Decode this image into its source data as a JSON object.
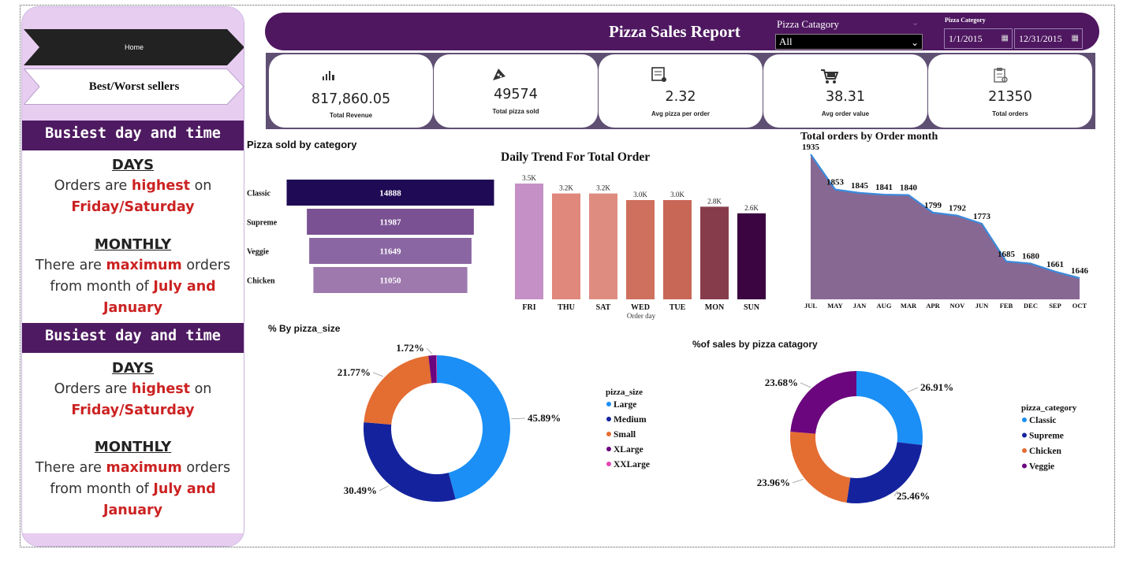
{
  "sidebar": {
    "nav": [
      {
        "label": "Home"
      },
      {
        "label": "Best/Worst sellers"
      }
    ],
    "sections": [
      {
        "banner": "Busiest day and time",
        "days_heading": "DAYS",
        "days_pre": "Orders are",
        "days_highlight": "highest",
        "days_post": "on",
        "days_value": "Friday/Saturday",
        "monthly_heading": "MONTHLY",
        "monthly_pre": "There are",
        "monthly_highlight": "maximum",
        "monthly_post": "orders",
        "monthly_line2": "from month of",
        "monthly_value1": "July and",
        "monthly_value2": "January"
      },
      {
        "banner": "Busiest day and time",
        "days_heading": "DAYS",
        "days_pre": "Orders are",
        "days_highlight": "highest",
        "days_post": "on",
        "days_value": "Friday/Saturday",
        "monthly_heading": "MONTHLY",
        "monthly_pre": "There are",
        "monthly_highlight": "maximum",
        "monthly_post": "orders",
        "monthly_line2": "from month of",
        "monthly_value1": "July and",
        "monthly_value2": "January"
      }
    ]
  },
  "header": {
    "title": "Pizza Sales Report",
    "category_filter_label": "Pizza Catagory",
    "category_filter_value": "All",
    "date_filter_label": "Pizza Category",
    "date_start": "1/1/2015",
    "date_end": "12/31/2015"
  },
  "kpis": [
    {
      "icon": "bar-chart-icon",
      "value": "817,860.05",
      "label": "Total Revenue"
    },
    {
      "icon": "pizza-icon",
      "value": "49574",
      "label": "Total pizza sold"
    },
    {
      "icon": "receipt-icon",
      "value": "2.32",
      "label": "Avg pizza per order"
    },
    {
      "icon": "cart-icon",
      "value": "38.31",
      "label": "Avg order value"
    },
    {
      "icon": "clipboard-icon",
      "value": "21350",
      "label": "Total orders"
    }
  ],
  "colors": {
    "purple_dark": "#4e1760",
    "accent_red": "#cc2222",
    "area_fill": "#876893",
    "area_line": "#3b8bdc"
  },
  "chart_data": [
    {
      "id": "category_funnel",
      "type": "bar",
      "title": "Pizza sold by category",
      "categories": [
        "Classic",
        "Supreme",
        "Veggie",
        "Chicken"
      ],
      "values": [
        14888,
        11987,
        11649,
        11050
      ],
      "colors": [
        "#1f0a55",
        "#7a5192",
        "#8a66a2",
        "#9d79ad"
      ]
    },
    {
      "id": "daily_trend",
      "type": "bar",
      "title": "Daily Trend For Total Order",
      "xlabel": "Order day",
      "categories": [
        "FRI",
        "THU",
        "SAT",
        "WED",
        "TUE",
        "MON",
        "SUN"
      ],
      "values": [
        3500,
        3200,
        3200,
        3000,
        3000,
        2800,
        2600
      ],
      "data_labels": [
        "3.5K",
        "3.2K",
        "3.2K",
        "3.0K",
        "3.0K",
        "2.8K",
        "2.6K"
      ],
      "colors": [
        "#c490c5",
        "#e0887c",
        "#df8c80",
        "#cf6f5d",
        "#c96757",
        "#873c4b",
        "#3a0540"
      ]
    },
    {
      "id": "monthly_orders",
      "type": "area",
      "title": "Total orders by Order month",
      "categories": [
        "JUL",
        "MAY",
        "JAN",
        "AUG",
        "MAR",
        "APR",
        "NOV",
        "JUN",
        "FEB",
        "DEC",
        "SEP",
        "OCT"
      ],
      "values": [
        1935,
        1853,
        1845,
        1841,
        1840,
        1799,
        1792,
        1773,
        1685,
        1680,
        1661,
        1646
      ]
    },
    {
      "id": "size_donut",
      "type": "pie",
      "title": "% By pizza_size",
      "legend_title": "pizza_size",
      "categories": [
        "Large",
        "Medium",
        "Small",
        "XLarge",
        "XXLarge"
      ],
      "values": [
        45.89,
        30.49,
        21.77,
        1.72,
        0.13
      ],
      "data_labels": [
        "45.89%",
        "30.49%",
        "21.77%",
        "1.72%",
        ""
      ],
      "colors": [
        "#1b8ff5",
        "#14239d",
        "#e46d32",
        "#6b067e",
        "#e346b3"
      ]
    },
    {
      "id": "category_donut",
      "type": "pie",
      "title": "%of sales by pizza catagory",
      "legend_title": "pizza_category",
      "categories": [
        "Classic",
        "Supreme",
        "Chicken",
        "Veggie"
      ],
      "values": [
        26.91,
        25.46,
        23.96,
        23.68
      ],
      "data_labels": [
        "26.91%",
        "25.46%",
        "23.96%",
        "23.68%"
      ],
      "colors": [
        "#1b8ff5",
        "#14239d",
        "#e46d32",
        "#6b067e"
      ]
    }
  ]
}
